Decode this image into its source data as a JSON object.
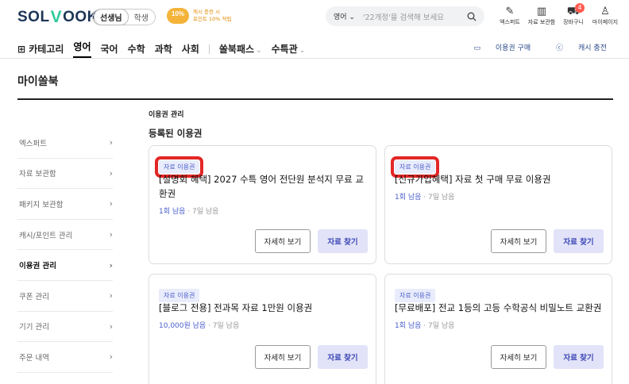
{
  "header": {
    "logo_left": "SOL",
    "logo_v": "V",
    "logo_right": "OOK",
    "seg_teacher": "선생님",
    "seg_student": "학생",
    "promo_line1": "캐시 충전 시",
    "promo_line2": "포인트 10% 적립",
    "search_select": "영어 ⌄",
    "search_placeholder": "'22개정'을 검색해 보세요",
    "icons": [
      {
        "label": "엑스퍼트",
        "icon": "pen-icon"
      },
      {
        "label": "자료 보관함",
        "icon": "books-icon"
      },
      {
        "label": "장바구니",
        "icon": "cart-icon",
        "badge": "4"
      },
      {
        "label": "마이페이지",
        "icon": "user-icon"
      }
    ]
  },
  "nav": {
    "category": "카테고리",
    "items": [
      "영어",
      "국어",
      "수학",
      "과학",
      "사회"
    ],
    "pass": "쏠북패스",
    "special": "수특관",
    "voucher_buy": "이용권 구매",
    "cash_charge": "캐시 충전"
  },
  "page_title": "마이쏠북",
  "sidebar": [
    {
      "label": "엑스퍼트",
      "active": false
    },
    {
      "label": "자료 보관함",
      "active": false
    },
    {
      "label": "패키지 보관함",
      "active": false
    },
    {
      "label": "캐시/포인트 관리",
      "active": false
    },
    {
      "label": "이용권 관리",
      "active": true
    },
    {
      "label": "쿠폰 관리",
      "active": false
    },
    {
      "label": "기기 관리",
      "active": false
    },
    {
      "label": "주문 내역",
      "active": false
    }
  ],
  "content": {
    "section_label": "이용권 관리",
    "section_title": "등록된 이용권",
    "cards": [
      {
        "tag": "자료 이용권",
        "title": "[설명회 혜택] 2027 수특 영어 전단원 분석지 무료 교환권",
        "count": "1회 남음",
        "days": "7일 남음",
        "detail_btn": "자세히 보기",
        "find_btn": "자료 찾기"
      },
      {
        "tag": "자료 이용권",
        "title": "[신규가입혜택] 자료 첫 구매 무료 이용권",
        "count": "1회 남음",
        "days": "7일 남음",
        "detail_btn": "자세히 보기",
        "find_btn": "자료 찾기"
      },
      {
        "tag": "자료 이용권",
        "title": "[블로그 전용] 전과목 자료 1만원 이용권",
        "count": "10,000원 남음",
        "days": "7일 남음",
        "detail_btn": "자세히 보기",
        "find_btn": "자료 찾기"
      },
      {
        "tag": "자료 이용권",
        "title": "[무료배포] 전교 1등의 고등 수학공식 비밀노트 교환권",
        "count": "1회 남음",
        "days": "7일 남음",
        "detail_btn": "자세히 보기",
        "find_btn": "자료 찾기"
      }
    ]
  }
}
